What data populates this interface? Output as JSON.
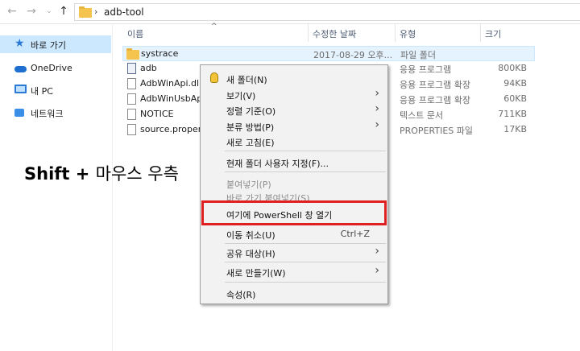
{
  "address": {
    "path": "adb-tool"
  },
  "sidebar": {
    "items": [
      {
        "label": "바로 가기",
        "icon": "star-icon"
      },
      {
        "label": "OneDrive",
        "icon": "cloud-icon"
      },
      {
        "label": "내 PC",
        "icon": "pc-icon"
      },
      {
        "label": "네트워크",
        "icon": "network-icon"
      }
    ]
  },
  "columns": {
    "name": "이름",
    "date": "수정한 날짜",
    "type": "유형",
    "size": "크기"
  },
  "files": [
    {
      "name": "systrace",
      "date": "2017-08-29 오후...",
      "type": "파일 폴더",
      "size": ""
    },
    {
      "name": "adb",
      "date": "",
      "type": "응용 프로그램",
      "size": "800KB"
    },
    {
      "name": "AdbWinApi.dll",
      "date": "",
      "type": "응용 프로그램 확장",
      "size": "94KB"
    },
    {
      "name": "AdbWinUsbApi...",
      "date": "",
      "type": "응용 프로그램 확장",
      "size": "60KB"
    },
    {
      "name": "NOTICE",
      "date": "",
      "type": "텍스트 문서",
      "size": "711KB"
    },
    {
      "name": "source.propertie",
      "date": "",
      "type": "PROPERTIES 파일",
      "size": "17KB"
    }
  ],
  "overlay": {
    "bold": "Shift + ",
    "rest": "마우스 우측"
  },
  "menu": {
    "items": [
      {
        "label": "새 폴더(N)"
      },
      {
        "label": "보기(V)"
      },
      {
        "label": "정렬 기준(O)"
      },
      {
        "label": "분류 방법(P)"
      },
      {
        "label": "새로 고침(E)"
      },
      {
        "label": "현재 폴더 사용자 지정(F)..."
      },
      {
        "label": "붙여넣기(P)"
      },
      {
        "label": "바로 가기 붙여넣기(S)"
      },
      {
        "label": "여기에 PowerShell 창 열기"
      },
      {
        "label": "이동 취소(U)",
        "shortcut": "Ctrl+Z"
      },
      {
        "label": "공유 대상(H)"
      },
      {
        "label": "새로 만들기(W)"
      },
      {
        "label": "속성(R)"
      }
    ]
  },
  "colors": {
    "highlight": "#e02020",
    "selection": "#cce8ff",
    "folder": "#f4c44e"
  }
}
